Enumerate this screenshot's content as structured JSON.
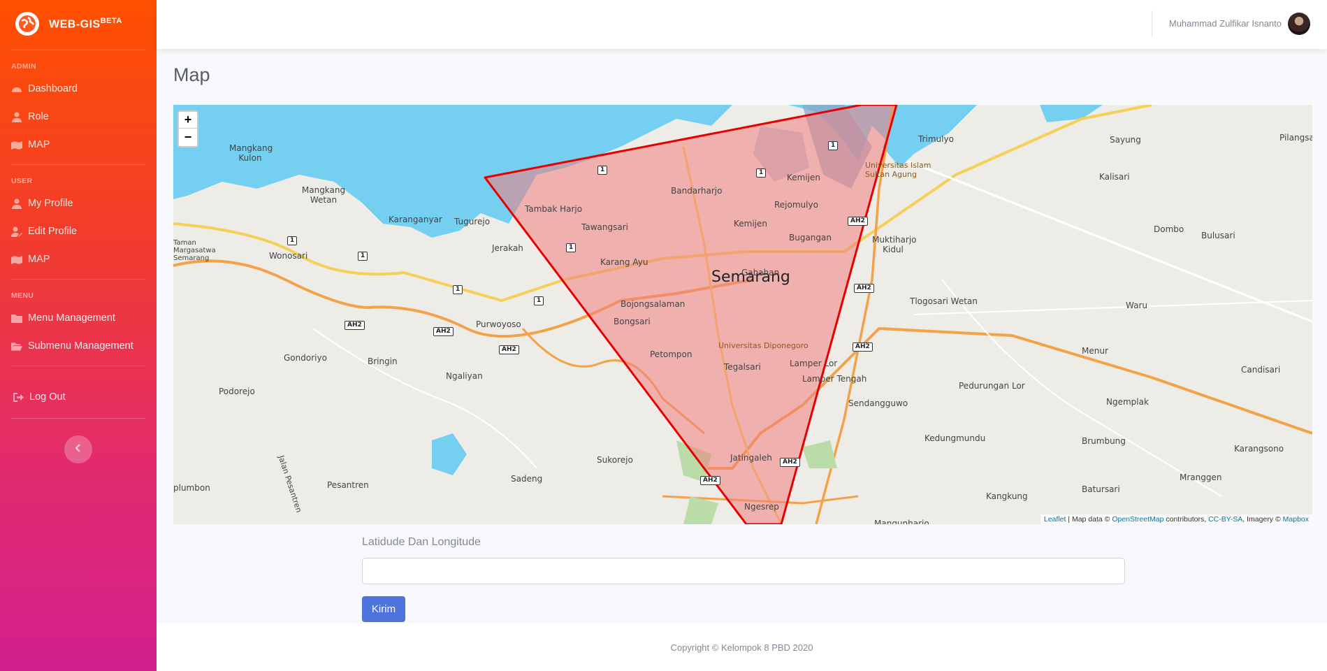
{
  "brand": {
    "name": "WEB-GIS",
    "badge": "BETA"
  },
  "sidebar": {
    "sections": [
      {
        "heading": "ADMIN",
        "items": [
          {
            "label": "Dashboard",
            "icon": "dashboard-icon"
          },
          {
            "label": "Role",
            "icon": "user-icon"
          },
          {
            "label": "MAP",
            "icon": "map-icon"
          }
        ]
      },
      {
        "heading": "USER",
        "items": [
          {
            "label": "My Profile",
            "icon": "user-icon"
          },
          {
            "label": "Edit Profile",
            "icon": "user-edit-icon"
          },
          {
            "label": "MAP",
            "icon": "map-icon"
          }
        ]
      },
      {
        "heading": "MENU",
        "items": [
          {
            "label": "Menu Management",
            "icon": "folder-icon"
          },
          {
            "label": "Submenu Management",
            "icon": "folder-open-icon"
          }
        ]
      }
    ],
    "logout": "Log Out"
  },
  "topbar": {
    "user_name": "Muhammad Zulfikar Isnanto"
  },
  "page": {
    "title": "Map"
  },
  "map": {
    "zoom_in": "+",
    "zoom_out": "−",
    "attribution": {
      "leaflet": "Leaflet",
      "mapdata": " | Map data © ",
      "osm": "OpenStreetMap",
      "contrib": " contributors, ",
      "ccbysa": "CC-BY-SA",
      "imagery": ", Imagery © ",
      "mapbox": "Mapbox"
    },
    "city": "Semarang",
    "labels": [
      "Mangkang Kulon",
      "Mangkang Wetan",
      "Karanganyar",
      "Tugurejo",
      "Jerakah",
      "Tambak Harjo",
      "Tawangsari",
      "Karang Ayu",
      "Bandarharjo",
      "Kemijen",
      "Rejomulyo",
      "Kemijen",
      "Bugangan",
      "Gabahan",
      "Bojongsalaman",
      "Bongsari",
      "Petompon",
      "Tegalsari",
      "Lamper Lor",
      "Lamper Tengah",
      "Jatingaleh",
      "Ngesrep",
      "Sukorejo",
      "Sadeng",
      "Pesantren",
      "Podorejo",
      "Gondoriyo",
      "Bringin",
      "Ngaliyan",
      "Purwoyoso",
      "Wonosari",
      "Trimulyo",
      "Sayung",
      "Kalisari",
      "Dombo",
      "Bulusari",
      "Pilangsari",
      "Muktiharjo Kidul",
      "Tlogosari Wetan",
      "Waru",
      "Menur",
      "Candisari",
      "Pedurungan Lor",
      "Sendangguwo",
      "Kedungmundu",
      "Ngemplak",
      "Brumbung",
      "Karangsono",
      "Mranggen",
      "Batursari",
      "Kangkung",
      "Mangunharjo",
      "Jalan Pesantren",
      "plumbon",
      "Taman Margasatwa Semarang"
    ],
    "universities": [
      "Universitas Islam Sultan Agung",
      "Universitas Diponegoro"
    ],
    "road_shields": [
      "1",
      "1",
      "1",
      "1",
      "1",
      "1",
      "1",
      "1",
      "AH2",
      "AH2",
      "AH2",
      "AH2",
      "AH2",
      "AH2",
      "AH2",
      "AH2"
    ]
  },
  "form": {
    "label": "Latidude Dan Longitude",
    "value": "",
    "submit": "Kirim"
  },
  "footer": {
    "copyright": "Copyright © Kelompok 8 PBD 2020"
  }
}
